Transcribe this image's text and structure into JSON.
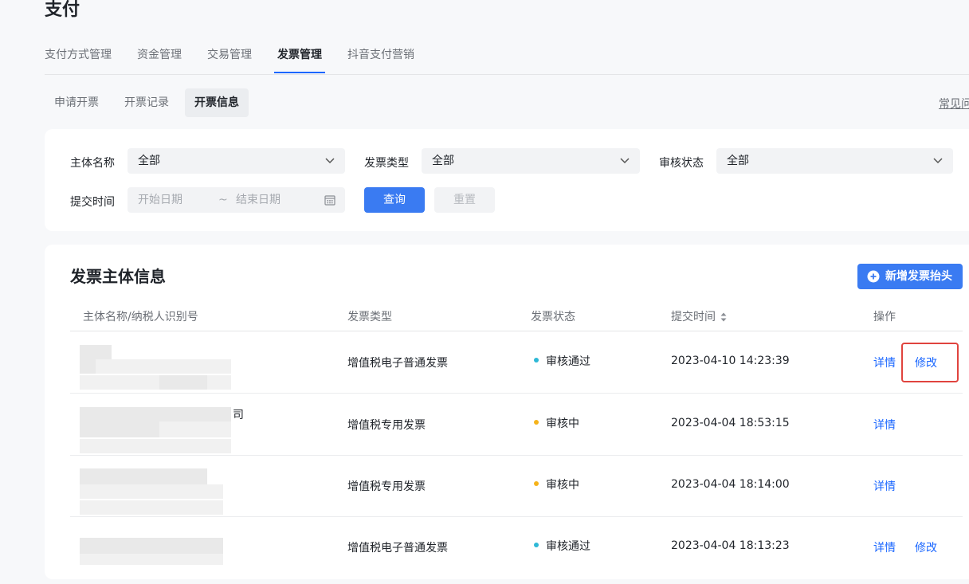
{
  "page": {
    "title": "支付"
  },
  "main_tabs": [
    {
      "label": "支付方式管理",
      "active": false
    },
    {
      "label": "资金管理",
      "active": false
    },
    {
      "label": "交易管理",
      "active": false
    },
    {
      "label": "发票管理",
      "active": true
    },
    {
      "label": "抖音支付营销",
      "active": false
    }
  ],
  "sub_tabs": [
    {
      "label": "申请开票",
      "active": false
    },
    {
      "label": "开票记录",
      "active": false
    },
    {
      "label": "开票信息",
      "active": true
    }
  ],
  "faq_link": "常见问",
  "filters": {
    "entity_label": "主体名称",
    "entity_value": "全部",
    "invoice_type_label": "发票类型",
    "invoice_type_value": "全部",
    "review_status_label": "审核状态",
    "review_status_value": "全部",
    "submit_time_label": "提交时间",
    "start_date_placeholder": "开始日期",
    "date_separator": "~",
    "end_date_placeholder": "结束日期",
    "query_button": "查询",
    "reset_button": "重置"
  },
  "table": {
    "title": "发票主体信息",
    "add_button": "新增发票抬头",
    "columns": [
      "主体名称/纳税人识别号",
      "发票类型",
      "发票状态",
      "提交时间",
      "操作"
    ],
    "rows": [
      {
        "entity_suffix": "",
        "invoice_type": "增值税电子普通发票",
        "status": "审核通过",
        "status_color": "#2eb8d6",
        "submit_time": "2023-04-10 14:23:39",
        "detail": "详情",
        "edit": "修改"
      },
      {
        "entity_suffix": "司",
        "invoice_type": "增值税专用发票",
        "status": "审核中",
        "status_color": "#f5b31b",
        "submit_time": "2023-04-04 18:53:15",
        "detail": "详情",
        "edit": ""
      },
      {
        "entity_suffix": "",
        "invoice_type": "增值税专用发票",
        "status": "审核中",
        "status_color": "#f5b31b",
        "submit_time": "2023-04-04 18:14:00",
        "detail": "详情",
        "edit": ""
      },
      {
        "entity_suffix": "",
        "invoice_type": "增值税电子普通发票",
        "status": "审核通过",
        "status_color": "#2eb8d6",
        "submit_time": "2023-04-04 18:13:23",
        "detail": "详情",
        "edit": "修改"
      }
    ]
  },
  "colors": {
    "accent": "#1966ff",
    "primary_button": "#3a7bf2",
    "highlight": "#e0443e"
  }
}
